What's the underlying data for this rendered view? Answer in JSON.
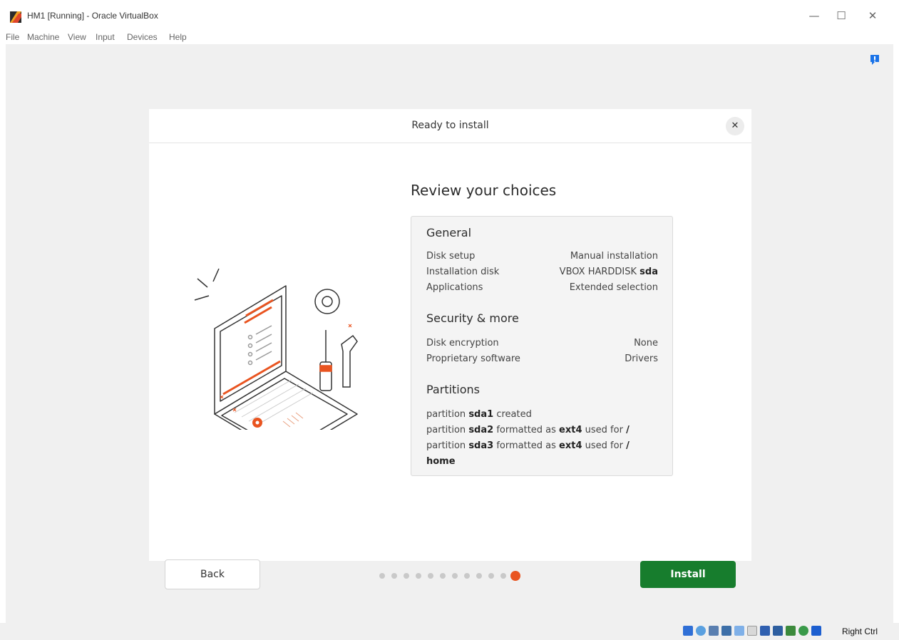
{
  "window": {
    "title": "HM1 [Running] - Oracle VirtualBox",
    "controls": {
      "minimize": "—",
      "maximize": "☐",
      "close": "✕"
    }
  },
  "menu": [
    "File",
    "Machine",
    "View",
    "Input",
    "Devices",
    "Help"
  ],
  "dialog": {
    "header_title": "Ready to install",
    "close_glyph": "✕",
    "heading": "Review your choices",
    "general": {
      "title": "General",
      "rows": [
        {
          "label": "Disk setup",
          "value": "Manual installation"
        },
        {
          "label": "Installation disk",
          "value_prefix": "VBOX HARDDISK ",
          "value_bold": "sda"
        },
        {
          "label": "Applications",
          "value": "Extended selection"
        }
      ]
    },
    "security": {
      "title": "Security & more",
      "rows": [
        {
          "label": "Disk encryption",
          "value": "None"
        },
        {
          "label": "Proprietary software",
          "value": "Drivers"
        }
      ]
    },
    "partitions": {
      "title": "Partitions",
      "lines": [
        {
          "w1": "partition ",
          "b1": "sda1",
          "w2": " created",
          "b2": "",
          "w3": "",
          "b3": ""
        },
        {
          "w1": "partition ",
          "b1": "sda2",
          "w2": " formatted as ",
          "b2": "ext4",
          "w3": " used for ",
          "b3": "/"
        },
        {
          "w1": "partition ",
          "b1": "sda3",
          "w2": " formatted as ",
          "b2": "ext4",
          "w3": " used for ",
          "b3": "/"
        }
      ],
      "wrap_bold": "home"
    },
    "back_label": "Back",
    "install_label": "Install",
    "progress": {
      "total_steps": 12,
      "current_step": 12
    }
  },
  "statusbar": {
    "host_key": "Right Ctrl"
  },
  "colors": {
    "accent": "#e95420",
    "install": "#177d2d",
    "background": "#f0f0f0"
  }
}
